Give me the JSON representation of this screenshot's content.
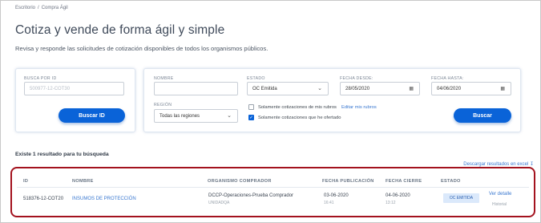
{
  "breadcrumb": {
    "home": "Escritorio",
    "separator": "/",
    "current": "Compra Ágil"
  },
  "page": {
    "title": "Cotiza y vende de forma ágil y simple",
    "subtitle": "Revisa y responde las solicitudes de cotización disponibles de todos los organismos públicos."
  },
  "search_id": {
    "label": "BUSCA POR ID",
    "placeholder": "500977-12-COT30",
    "button": "Buscar ID"
  },
  "filters": {
    "nombre_label": "NOMBRE",
    "nombre_value": "",
    "estado_label": "ESTADO",
    "estado_value": "OC Emitida",
    "fecha_desde_label": "FECHA DESDE:",
    "fecha_desde_value": "28/05/2020",
    "fecha_hasta_label": "FECHA HASTA:",
    "fecha_hasta_value": "04/06/2020",
    "region_label": "REGIÓN",
    "region_value": "Todas las regiones",
    "check_rubros_label": "Solamente cotizaciones de mis rubros",
    "check_rubros_checked": false,
    "edit_rubros_link": "Editar mis rubros",
    "check_ofertado_label": "Solamente cotizaciones que he ofertado",
    "check_ofertado_checked": true,
    "search_button": "Buscar",
    "accent_color": "#0a63d8"
  },
  "results": {
    "summary": "Existe 1 resultado para tu búsqueda",
    "download_link": "Descargar resultados en excel",
    "columns": {
      "id": "ID",
      "nombre": "NOMBRE",
      "organismo": "ORGANISMO COMPRADOR",
      "fecha_publicacion": "FECHA PUBLICACIÓN",
      "fecha_cierre": "FECHA CIERRE",
      "estado": "ESTADO"
    },
    "rows": [
      {
        "id": "518376-12-COT20",
        "nombre": "INSUMOS DE PROTECCIÓN",
        "organismo": "DCCP-Operaciones-Prueba Comprador",
        "unidad": "UNIDADQA",
        "fecha_publicacion": "03-06-2020",
        "hora_publicacion": "16:41",
        "fecha_cierre": "04-06-2020",
        "hora_cierre": "13:12",
        "estado": "OC EMITIDA",
        "ver_detalle": "Ver detalle",
        "historial": "Historial"
      }
    ],
    "highlight_color": "#a3121e"
  }
}
